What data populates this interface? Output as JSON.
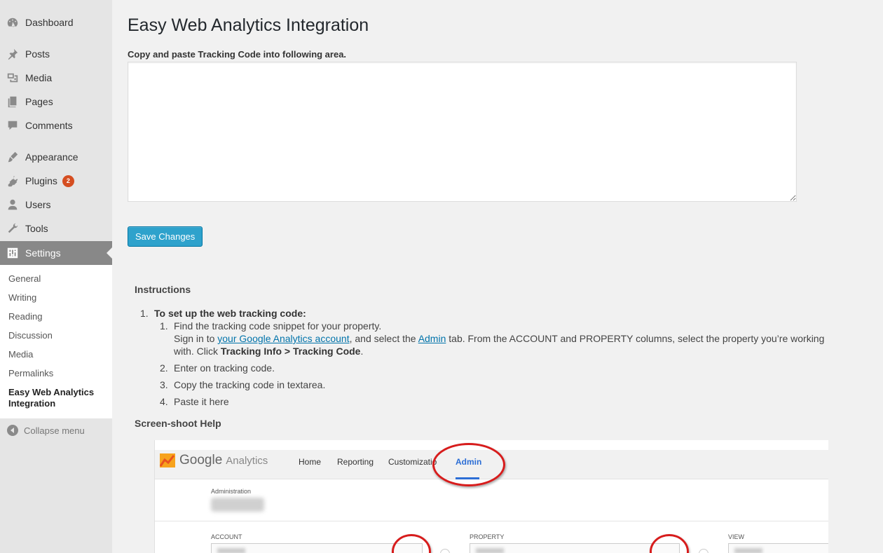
{
  "sidebar": {
    "items": [
      {
        "label": "Dashboard",
        "icon": "dashboard-icon"
      },
      {
        "label": "Posts",
        "icon": "pin-icon"
      },
      {
        "label": "Media",
        "icon": "media-icon"
      },
      {
        "label": "Pages",
        "icon": "pages-icon"
      },
      {
        "label": "Comments",
        "icon": "comment-icon"
      },
      {
        "label": "Appearance",
        "icon": "brush-icon"
      },
      {
        "label": "Plugins",
        "icon": "plug-icon",
        "badge": "2"
      },
      {
        "label": "Users",
        "icon": "user-icon"
      },
      {
        "label": "Tools",
        "icon": "wrench-icon"
      },
      {
        "label": "Settings",
        "icon": "settings-icon",
        "current": true
      }
    ],
    "submenu": [
      "General",
      "Writing",
      "Reading",
      "Discussion",
      "Media",
      "Permalinks",
      "Easy Web Analytics Integration"
    ],
    "collapse_label": "Collapse menu"
  },
  "main": {
    "title": "Easy Web Analytics Integration",
    "lead": "Copy and paste Tracking Code into following area.",
    "textarea_value": "",
    "save_label": "Save Changes",
    "instructions_title": "Instructions",
    "step1": {
      "num": "1.",
      "title": "To set up the web tracking code:"
    },
    "substeps": {
      "s1": {
        "num": "1.",
        "line1": "Find the tracking code snippet for your property.",
        "sign_in": "Sign in to ",
        "link1": "your Google Analytics account",
        "mid": ", and select the ",
        "link2": "Admin",
        "rest": " tab. From the ACCOUNT and PROPERTY columns, select the property you’re working with. Click ",
        "bold": "Tracking Info > Tracking Code",
        "end": "."
      },
      "s2": {
        "num": "2.",
        "text": "Enter on tracking code."
      },
      "s3": {
        "num": "3.",
        "text": "Copy the tracking code in textarea."
      },
      "s4": {
        "num": "4.",
        "text": "Paste it here"
      }
    },
    "help_title": "Screen-shoot Help"
  },
  "ga_screenshot": {
    "brand": "Google",
    "product": "Analytics",
    "nav": [
      "Home",
      "Reporting",
      "Customizatio",
      "Admin"
    ],
    "admin_label": "Administration",
    "columns": [
      "ACCOUNT",
      "PROPERTY",
      "VIEW"
    ],
    "highlight_color": "#d71c1c"
  },
  "colors": {
    "accent": "#2ea2cc",
    "badge": "#d54e21",
    "link": "#0073aa"
  }
}
